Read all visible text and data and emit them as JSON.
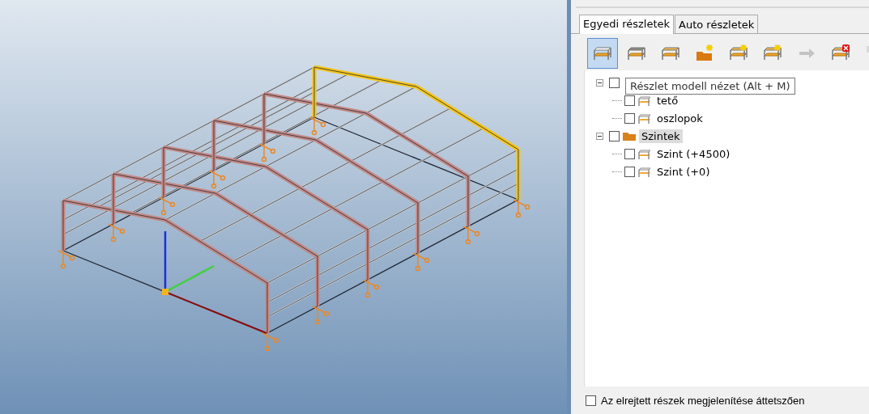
{
  "tabs": [
    {
      "label": "Egyedi részletek",
      "selected": true
    },
    {
      "label": "Auto részletek",
      "selected": false
    }
  ],
  "toolbar": [
    {
      "kind": "table-white",
      "selected": true,
      "disabled": false
    },
    {
      "kind": "table-grey",
      "selected": false,
      "disabled": false
    },
    {
      "kind": "table-orange",
      "selected": false,
      "disabled": false
    },
    {
      "kind": "new-folder",
      "selected": false,
      "disabled": false
    },
    {
      "kind": "new-detail",
      "selected": false,
      "disabled": false
    },
    {
      "kind": "new-level",
      "selected": false,
      "disabled": false
    },
    {
      "kind": "swap",
      "selected": false,
      "disabled": true
    },
    {
      "kind": "delete",
      "selected": false,
      "disabled": false
    },
    {
      "kind": "rename",
      "selected": false,
      "disabled": true
    }
  ],
  "tooltip": "Részlet modell nézet (Alt + M)",
  "tree": [
    {
      "checked": false,
      "expanded": true,
      "children": [
        {
          "kind": "detail",
          "label": "tető",
          "checked": false
        },
        {
          "kind": "detail",
          "label": "oszlopok",
          "checked": false
        }
      ]
    },
    {
      "kind": "folder",
      "label": "Szintek",
      "checked": false,
      "expanded": true,
      "highlighted": true,
      "children": [
        {
          "kind": "detail",
          "label": "Szint (+4500)",
          "checked": false
        },
        {
          "kind": "detail",
          "label": "Szint (+0)",
          "checked": false
        }
      ]
    }
  ],
  "transparent_option": {
    "label": "Az elrejtett részek megjelenítése áttetszően",
    "checked": false
  }
}
